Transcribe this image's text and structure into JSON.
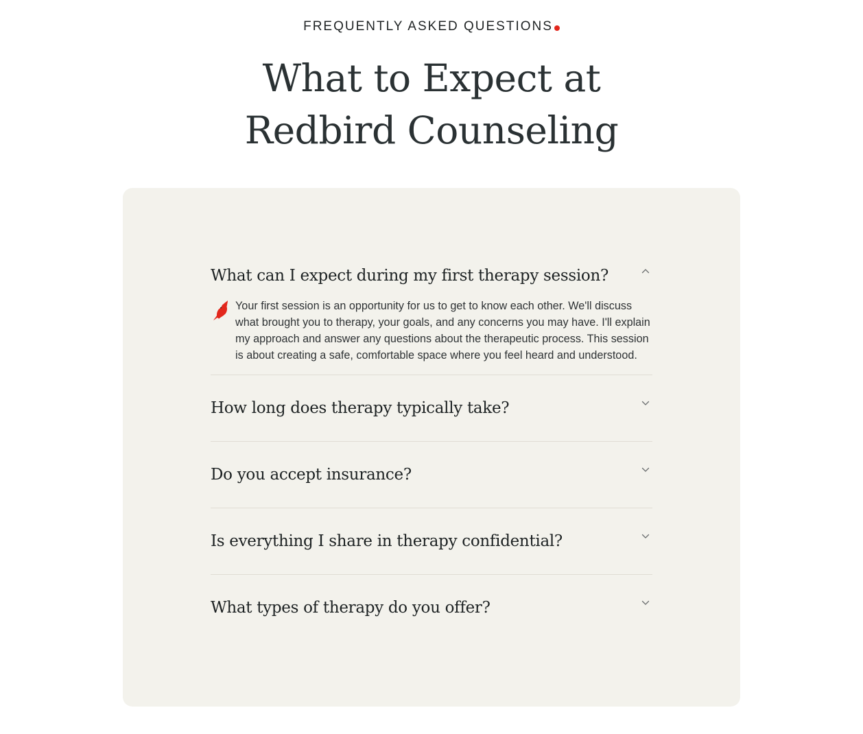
{
  "header": {
    "eyebrow": "FREQUENTLY ASKED QUESTIONS",
    "title_line1": "What to Expect at",
    "title_line2": "Redbird Counseling"
  },
  "colors": {
    "accent_red": "#e3271c",
    "card_bg": "#f3f2ec",
    "text_dark": "#2a3133"
  },
  "faq": [
    {
      "question": "What can I expect during my first therapy session?",
      "expanded": true,
      "answer": "Your first session is an opportunity for us to get to know each other. We'll discuss what brought you to therapy, your goals, and any concerns you may have. I'll explain my approach and answer any questions about the therapeutic process. This session is about creating a safe, comfortable space where you feel heard and understood.",
      "icon": "chevron-up-icon"
    },
    {
      "question": "How long does therapy typically take?",
      "expanded": false,
      "icon": "chevron-down-icon"
    },
    {
      "question": "Do you accept insurance?",
      "expanded": false,
      "icon": "chevron-down-icon"
    },
    {
      "question": "Is everything I share in therapy confidential?",
      "expanded": false,
      "icon": "chevron-down-icon"
    },
    {
      "question": "What types of therapy do you offer?",
      "expanded": false,
      "icon": "chevron-down-icon"
    }
  ],
  "answer_icon": "cardinal-bird-icon"
}
